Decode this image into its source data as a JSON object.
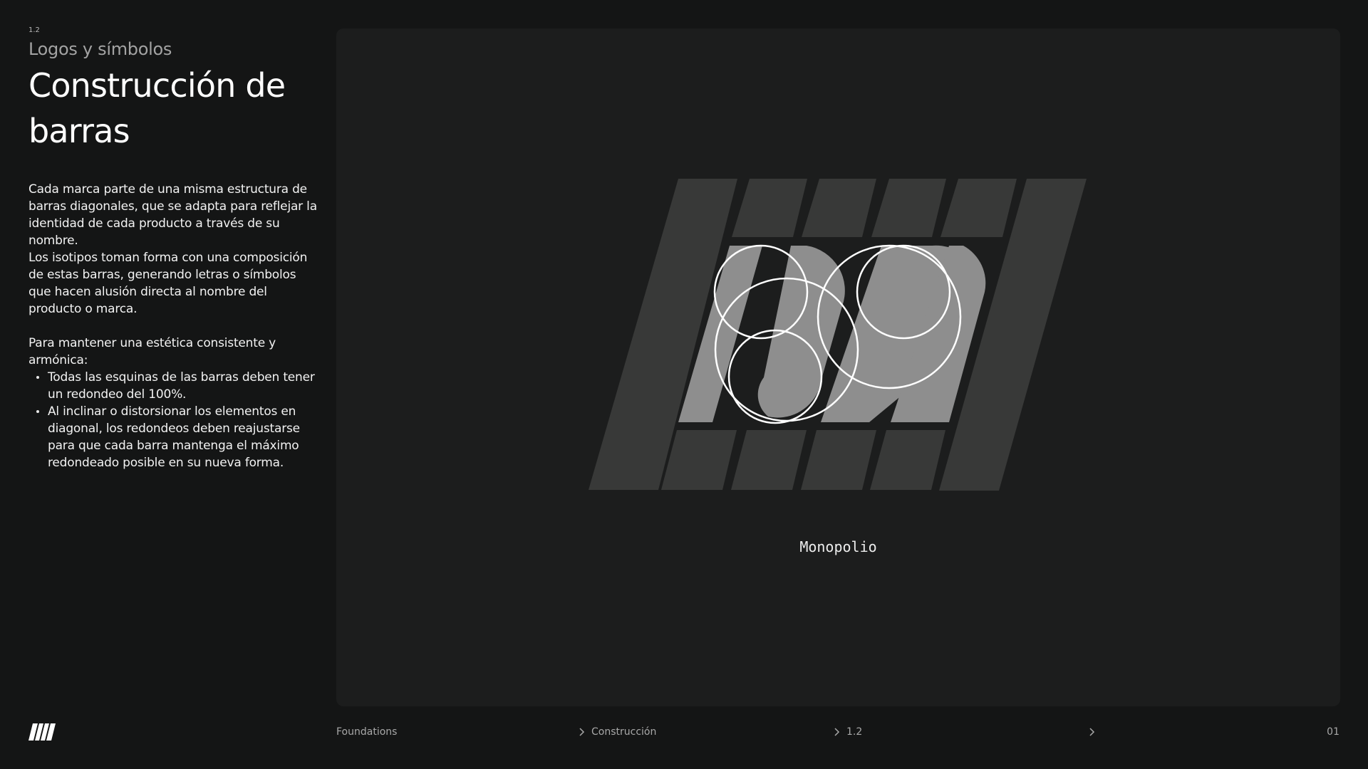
{
  "header": {
    "section_number": "1.2",
    "section_subtitle": "Logos y símbolos",
    "title_line1": "Construcción de",
    "title_line2": "barras"
  },
  "body": {
    "paragraph1": "Cada marca parte de una misma estructura de barras diagonales, que se adapta para reflejar la identidad de cada producto a través de su nombre.",
    "paragraph2": "Los isotipos toman forma con una composición de estas barras, generando letras o símbolos que hacen alusión directa al nombre del producto o marca.",
    "paragraph3": "Para mantener una estética consistente y armónica:",
    "bullets": [
      "Todas las esquinas de las barras deben tener un redondeo del 100%.",
      "Al inclinar o distorsionar los elementos en diagonal, los redondeos deben reajustarse para que cada barra mantenga el máximo redondeado posible en su nueva forma."
    ]
  },
  "figure": {
    "caption": "Monopolio",
    "colors": {
      "canvas": "#1c1d1d",
      "bar": "#383938",
      "letter": "#8e8e8e",
      "guide": "#ffffff"
    }
  },
  "footer": {
    "crumb1": "Foundations",
    "crumb2": "Construcción",
    "crumb3": "1.2",
    "page_number": "01",
    "icons": [
      "chevron-right-icon",
      "brand-bars-icon"
    ]
  }
}
